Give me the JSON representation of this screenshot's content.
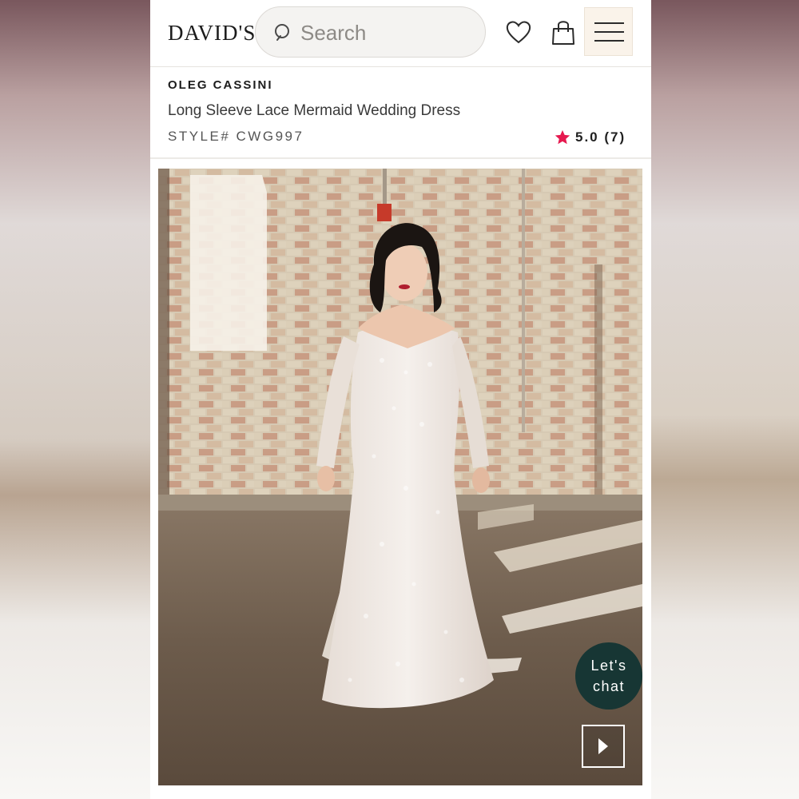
{
  "header": {
    "logo": "DAVID'S",
    "search_placeholder": "Search",
    "icons": [
      "search-icon",
      "heart-icon",
      "shopping-bag-icon",
      "hamburger-menu-icon"
    ]
  },
  "product": {
    "brand": "OLEG CASSINI",
    "name": "Long Sleeve Lace Mermaid Wedding Dress",
    "style": "STYLE# CWG997",
    "rating": "5.0 (7)",
    "rating_star_color": "#e6194f"
  },
  "media": {
    "chat_line1": "Let's",
    "chat_line2": "chat",
    "chat_color": "#173634",
    "play_icon": "play-icon"
  }
}
